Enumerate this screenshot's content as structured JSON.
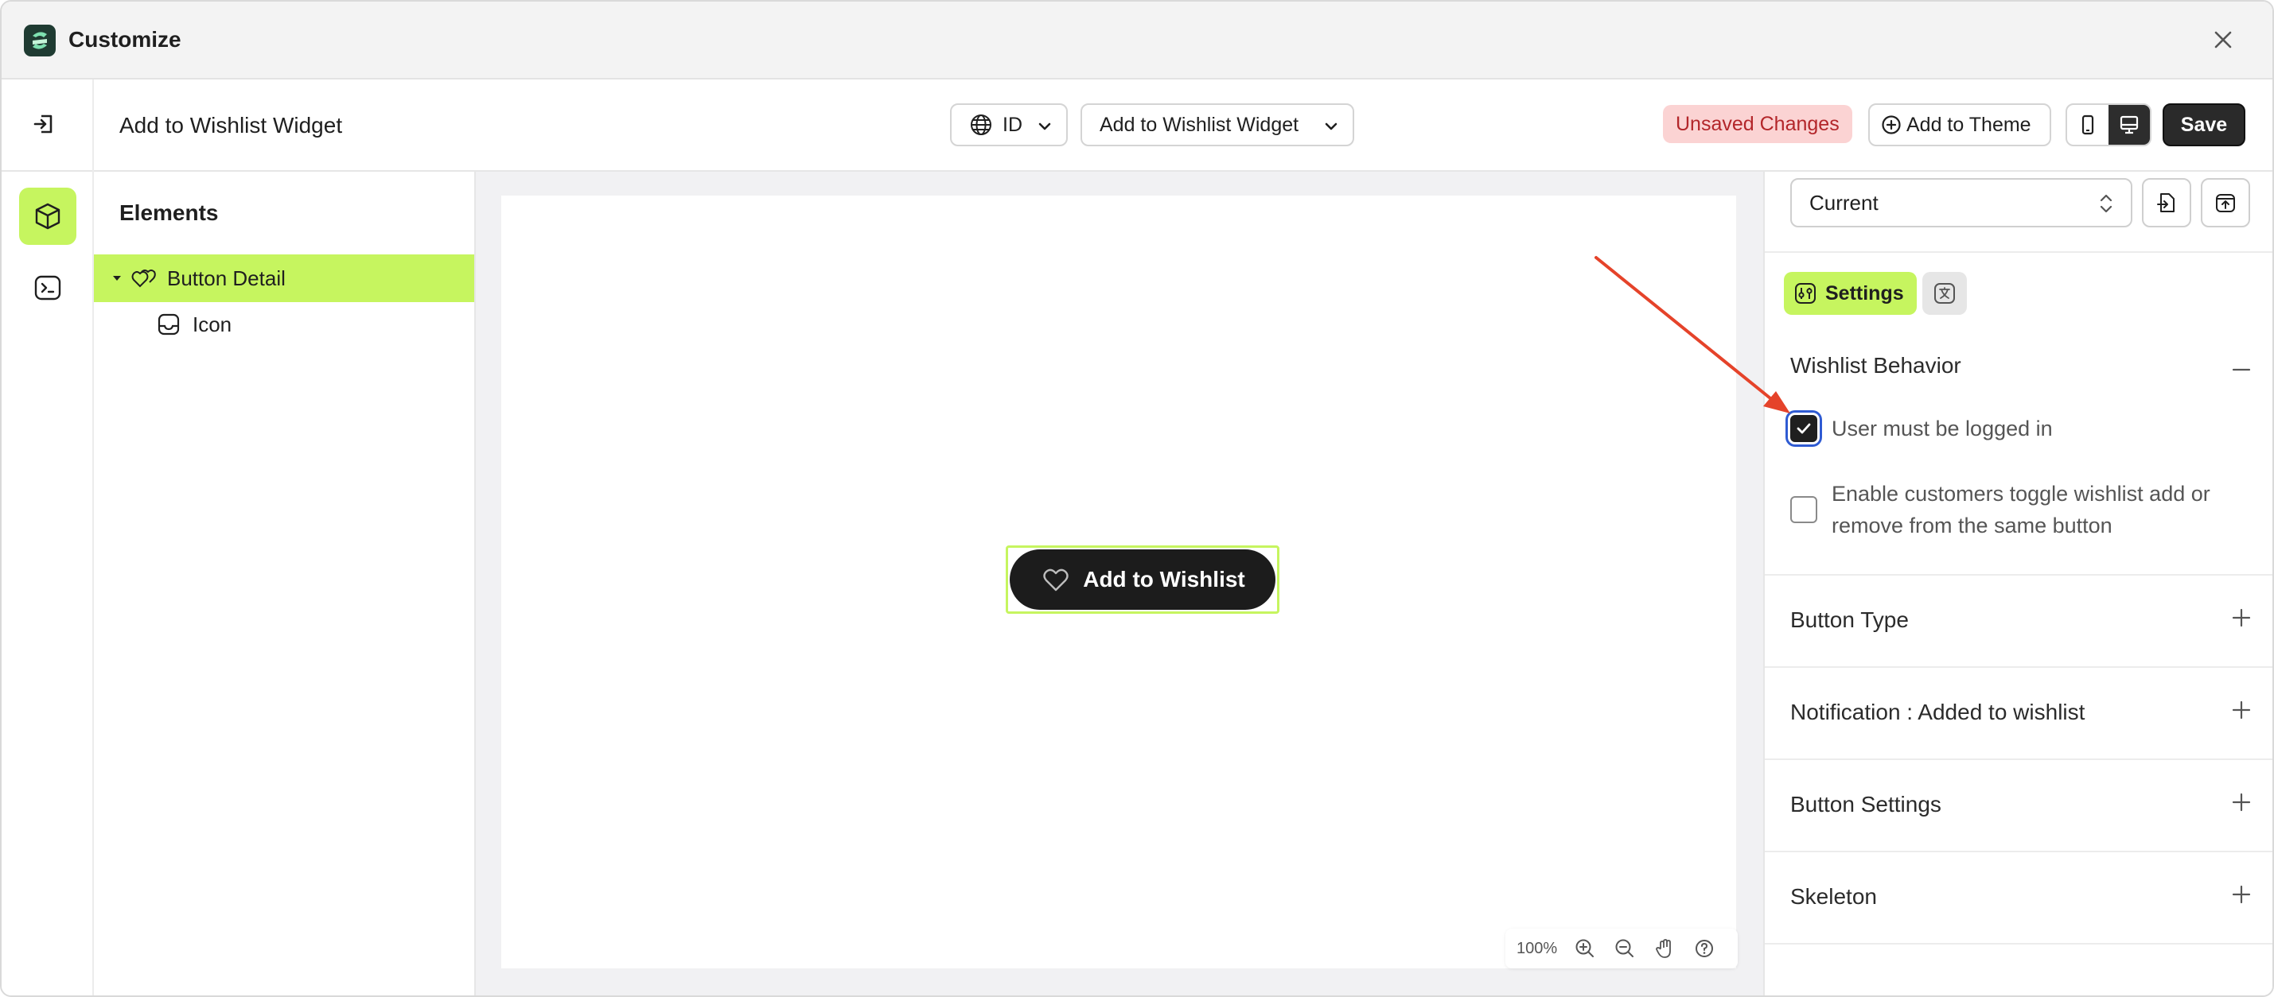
{
  "app": {
    "title": "Customize"
  },
  "header": {
    "page_title": "Add to Wishlist Widget",
    "language": "ID",
    "widget_select": "Add to Wishlist Widget",
    "unsaved_label": "Unsaved Changes",
    "add_theme_label": "Add to Theme",
    "save_label": "Save"
  },
  "elements": {
    "title": "Elements",
    "items": [
      {
        "label": "Button Detail",
        "selected": true
      },
      {
        "label": "Icon",
        "selected": false
      }
    ]
  },
  "canvas": {
    "button_label": "Add to Wishlist",
    "zoom_level": "100%"
  },
  "right_panel": {
    "version": "Current",
    "settings_tab": "Settings",
    "sections": [
      {
        "title": "Wishlist Behavior",
        "expanded": true
      },
      {
        "title": "Button Type",
        "expanded": false
      },
      {
        "title": "Notification : Added to wishlist",
        "expanded": false
      },
      {
        "title": "Button Settings",
        "expanded": false
      },
      {
        "title": "Skeleton",
        "expanded": false
      }
    ],
    "options": [
      {
        "label": "User must be logged in",
        "checked": true
      },
      {
        "label_line1": "Enable customers toggle wishlist add or",
        "label_line2": "remove from the same button",
        "checked": false
      }
    ]
  },
  "colors": {
    "accent": "#c6f55f",
    "dark": "#1c1c1c",
    "unsaved_bg": "#fbd3d3",
    "unsaved_text": "#b3262a",
    "annotation_arrow": "#e5432a"
  }
}
